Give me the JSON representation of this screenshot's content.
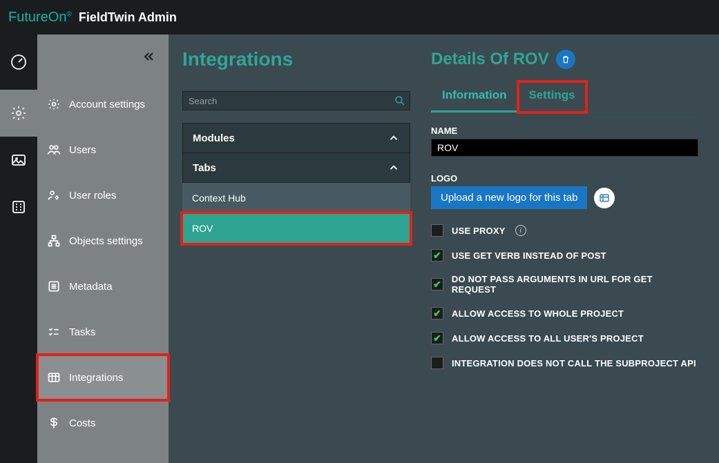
{
  "header": {
    "brand": "FutureOn",
    "app_title": "FieldTwin Admin"
  },
  "sidebar": {
    "items": [
      {
        "label": "Account settings"
      },
      {
        "label": "Users"
      },
      {
        "label": "User roles"
      },
      {
        "label": "Objects settings"
      },
      {
        "label": "Metadata"
      },
      {
        "label": "Tasks"
      },
      {
        "label": "Integrations"
      },
      {
        "label": "Costs"
      }
    ]
  },
  "page": {
    "title": "Integrations",
    "search_placeholder": "Search",
    "accordion": {
      "modules_label": "Modules",
      "tabs_label": "Tabs",
      "tabs_items": [
        {
          "label": "Context Hub"
        },
        {
          "label": "ROV"
        }
      ]
    }
  },
  "details": {
    "title": "Details Of ROV",
    "tabs": {
      "information": "Information",
      "settings": "Settings"
    },
    "form": {
      "name_label": "NAME",
      "name_value": "ROV",
      "logo_label": "LOGO",
      "upload_label": "Upload a new logo for this tab",
      "options": [
        {
          "label": "USE PROXY",
          "checked": false,
          "info": true
        },
        {
          "label": "USE GET VERB INSTEAD OF POST",
          "checked": true
        },
        {
          "label": "DO NOT PASS ARGUMENTS IN URL FOR GET REQUEST",
          "checked": true
        },
        {
          "label": "ALLOW ACCESS TO WHOLE PROJECT",
          "checked": true
        },
        {
          "label": "ALLOW ACCESS TO ALL USER'S PROJECT",
          "checked": true
        },
        {
          "label": "INTEGRATION DOES NOT CALL THE SUBPROJECT API",
          "checked": false
        }
      ]
    }
  }
}
